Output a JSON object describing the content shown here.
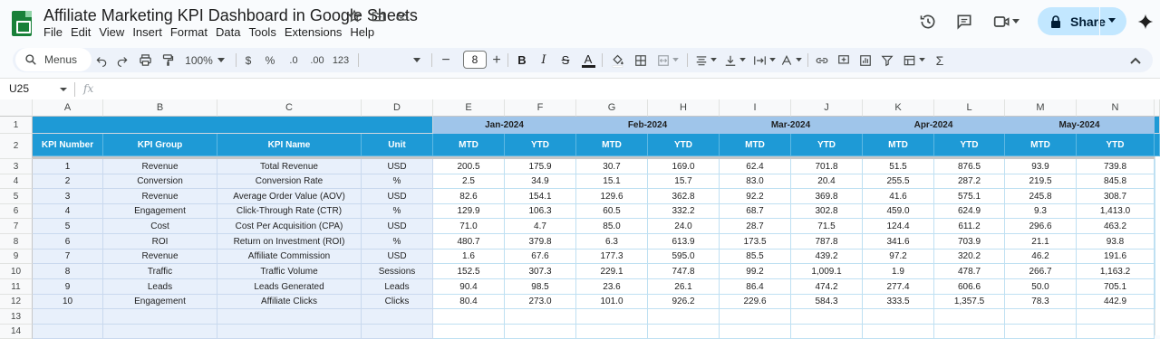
{
  "app": {
    "title": "Affiliate Marketing KPI Dashboard in Google Sheets",
    "menu": [
      "File",
      "Edit",
      "View",
      "Insert",
      "Format",
      "Data",
      "Tools",
      "Extensions",
      "Help"
    ],
    "share_label": "Share"
  },
  "toolbar": {
    "search_label": "Menus",
    "zoom": "100%",
    "currency": "$",
    "percent": "%",
    "decrease_decimal": ".0",
    "increase_decimal": ".00",
    "number_format": "123",
    "font_size": "8"
  },
  "formula_bar": {
    "name_box": "U25",
    "fx": "fx"
  },
  "columns": [
    "A",
    "B",
    "C",
    "D",
    "E",
    "F",
    "G",
    "H",
    "I",
    "J",
    "K",
    "L",
    "M",
    "N"
  ],
  "row_numbers": [
    "1",
    "2",
    "3",
    "4",
    "5",
    "6",
    "7",
    "8",
    "9",
    "10",
    "11",
    "12",
    "13",
    "14"
  ],
  "headers": {
    "kpi_number": "KPI Number",
    "kpi_group": "KPI Group",
    "kpi_name": "KPI Name",
    "unit": "Unit",
    "mtd": "MTD",
    "ytd": "YTD"
  },
  "months": [
    "Jan-2024",
    "Feb-2024",
    "Mar-2024",
    "Apr-2024",
    "May-2024"
  ],
  "rows": [
    {
      "num": "1",
      "group": "Revenue",
      "name": "Total Revenue",
      "unit": "USD",
      "values": [
        "200.5",
        "175.9",
        "30.7",
        "169.0",
        "62.4",
        "701.8",
        "51.5",
        "876.5",
        "93.9",
        "739.8"
      ]
    },
    {
      "num": "2",
      "group": "Conversion",
      "name": "Conversion Rate",
      "unit": "%",
      "values": [
        "2.5",
        "34.9",
        "15.1",
        "15.7",
        "83.0",
        "20.4",
        "255.5",
        "287.2",
        "219.5",
        "845.8"
      ]
    },
    {
      "num": "3",
      "group": "Revenue",
      "name": "Average Order Value (AOV)",
      "unit": "USD",
      "values": [
        "82.6",
        "154.1",
        "129.6",
        "362.8",
        "92.2",
        "369.8",
        "41.6",
        "575.1",
        "245.8",
        "308.7"
      ]
    },
    {
      "num": "4",
      "group": "Engagement",
      "name": "Click-Through Rate (CTR)",
      "unit": "%",
      "values": [
        "129.9",
        "106.3",
        "60.5",
        "332.2",
        "68.7",
        "302.8",
        "459.0",
        "624.9",
        "9.3",
        "1,413.0"
      ]
    },
    {
      "num": "5",
      "group": "Cost",
      "name": "Cost Per Acquisition (CPA)",
      "unit": "USD",
      "values": [
        "71.0",
        "4.7",
        "85.0",
        "24.0",
        "28.7",
        "71.5",
        "124.4",
        "611.2",
        "296.6",
        "463.2"
      ]
    },
    {
      "num": "6",
      "group": "ROI",
      "name": "Return on Investment (ROI)",
      "unit": "%",
      "values": [
        "480.7",
        "379.8",
        "6.3",
        "613.9",
        "173.5",
        "787.8",
        "341.6",
        "703.9",
        "21.1",
        "93.8"
      ]
    },
    {
      "num": "7",
      "group": "Revenue",
      "name": "Affiliate Commission",
      "unit": "USD",
      "values": [
        "1.6",
        "67.6",
        "177.3",
        "595.0",
        "85.5",
        "439.2",
        "97.2",
        "320.2",
        "46.2",
        "191.6"
      ]
    },
    {
      "num": "8",
      "group": "Traffic",
      "name": "Traffic Volume",
      "unit": "Sessions",
      "values": [
        "152.5",
        "307.3",
        "229.1",
        "747.8",
        "99.2",
        "1,009.1",
        "1.9",
        "478.7",
        "266.7",
        "1,163.2"
      ]
    },
    {
      "num": "9",
      "group": "Leads",
      "name": "Leads Generated",
      "unit": "Leads",
      "values": [
        "90.4",
        "98.5",
        "23.6",
        "26.1",
        "86.4",
        "474.2",
        "277.4",
        "606.6",
        "50.0",
        "705.1"
      ]
    },
    {
      "num": "10",
      "group": "Engagement",
      "name": "Affiliate Clicks",
      "unit": "Clicks",
      "values": [
        "80.4",
        "273.0",
        "101.0",
        "926.2",
        "229.6",
        "584.3",
        "333.5",
        "1,357.5",
        "78.3",
        "442.9"
      ]
    }
  ]
}
